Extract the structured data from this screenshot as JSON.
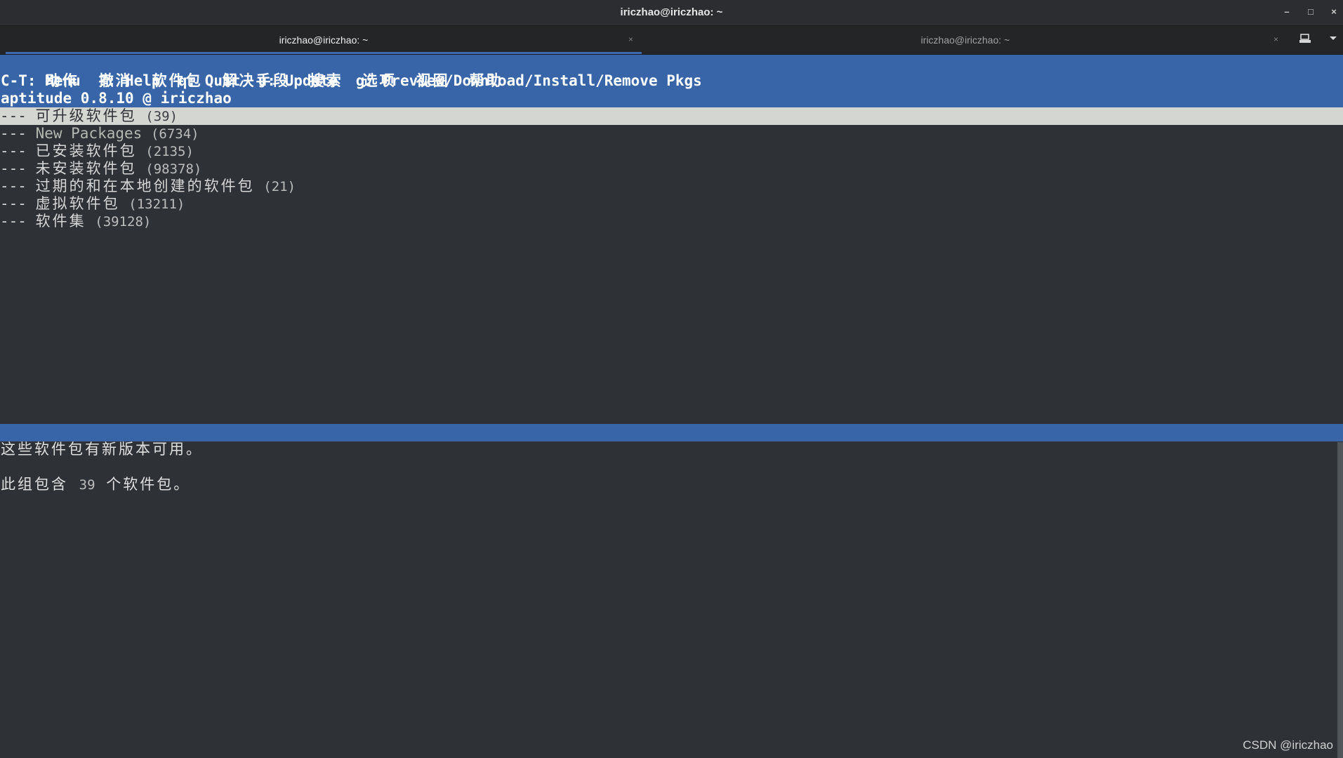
{
  "window": {
    "title": "iriczhao@iriczhao: ~",
    "minimize_glyph": "–",
    "maximize_glyph": "□",
    "close_glyph": "×"
  },
  "tabs": [
    {
      "label": "iriczhao@iriczhao: ~",
      "close_glyph": "×",
      "active": true
    },
    {
      "label": "iriczhao@iriczhao: ~",
      "close_glyph": "×",
      "active": false
    }
  ],
  "tab_tools": {
    "new_tab_icon": "new-tab-icon",
    "menu_icon": "chevron-down-icon"
  },
  "aptitude": {
    "menu": [
      "动作",
      "撤消",
      "软件包",
      "解决手段",
      "搜索",
      "选项",
      "视图",
      "帮助"
    ],
    "hint_line": "C-T: Menu  ?: Help  q: Quit  u: Update  g: Preview/Download/Install/Remove Pkgs",
    "status_line": "aptitude 0.8.10 @ iriczhao",
    "prefix": "---",
    "packages": [
      {
        "name": "可升级软件包",
        "count": "(39)",
        "selected": true
      },
      {
        "name": "New Packages",
        "count": "(6734)"
      },
      {
        "name": "已安装软件包",
        "count": "(2135)"
      },
      {
        "name": "未安装软件包",
        "count": "(98378)"
      },
      {
        "name": "过期的和在本地创建的软件包",
        "count": "(21)"
      },
      {
        "name": "虚拟软件包",
        "count": "(13211)"
      },
      {
        "name": "软件集",
        "count": "(39128)"
      }
    ],
    "description_line1": "这些软件包有新版本可用。",
    "description_line2_pre": "此组包含",
    "description_line2_num": "39",
    "description_line2_post": "个软件包。"
  },
  "watermark": "CSDN @iriczhao",
  "colors": {
    "accent_blue": "#3865a8",
    "terminal_bg": "#2e3236",
    "selection_bg": "#d4d6d2"
  }
}
